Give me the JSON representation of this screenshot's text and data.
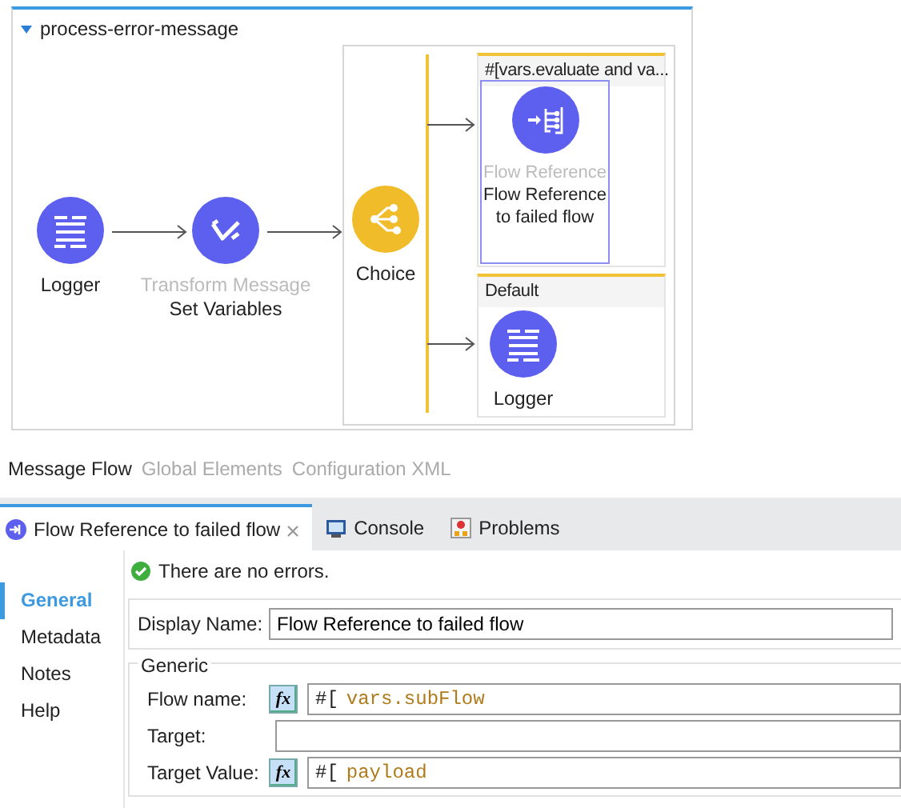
{
  "flow": {
    "title": "process-error-message",
    "expanded": true,
    "steps": [
      {
        "kind": "logger",
        "name": "Logger"
      },
      {
        "kind": "transform",
        "type_label": "Transform Message",
        "name": "Set Variables"
      },
      {
        "kind": "choice",
        "name": "Choice",
        "routes": [
          {
            "header": "#[vars.evaluate and va...",
            "nodes": [
              {
                "kind": "flow-reference",
                "type_label": "Flow Reference",
                "name": "Flow Reference to failed flow",
                "selected": true
              }
            ]
          },
          {
            "header": "Default",
            "nodes": [
              {
                "kind": "logger",
                "name": "Logger",
                "selected": false
              }
            ]
          }
        ]
      }
    ]
  },
  "editor_tabs": [
    {
      "label": "Message Flow",
      "selected": true
    },
    {
      "label": "Global Elements",
      "selected": false
    },
    {
      "label": "Configuration XML",
      "selected": false
    }
  ],
  "view_tabs": [
    {
      "kind": "flow-reference",
      "label": "Flow Reference to failed flow",
      "selected": true,
      "closable": true
    },
    {
      "kind": "console",
      "label": "Console",
      "selected": false,
      "closable": false
    },
    {
      "kind": "problems",
      "label": "Problems",
      "selected": false,
      "closable": false
    }
  ],
  "sidebar": [
    {
      "label": "General",
      "selected": true
    },
    {
      "label": "Metadata",
      "selected": false
    },
    {
      "label": "Notes",
      "selected": false
    },
    {
      "label": "Help",
      "selected": false
    }
  ],
  "status": "There are no errors.",
  "display_name": {
    "label": "Display Name:",
    "value": "Flow Reference to failed flow"
  },
  "generic": {
    "title": "Generic",
    "fields": [
      {
        "kind": "expression",
        "label": "Flow name:",
        "button": "fx",
        "prefix": "#[",
        "value": "vars.subFlow"
      },
      {
        "kind": "text",
        "label": "Target:"
      },
      {
        "kind": "expression",
        "label": "Target Value:",
        "button": "fx",
        "prefix": "#[",
        "value": "payload"
      }
    ]
  }
}
